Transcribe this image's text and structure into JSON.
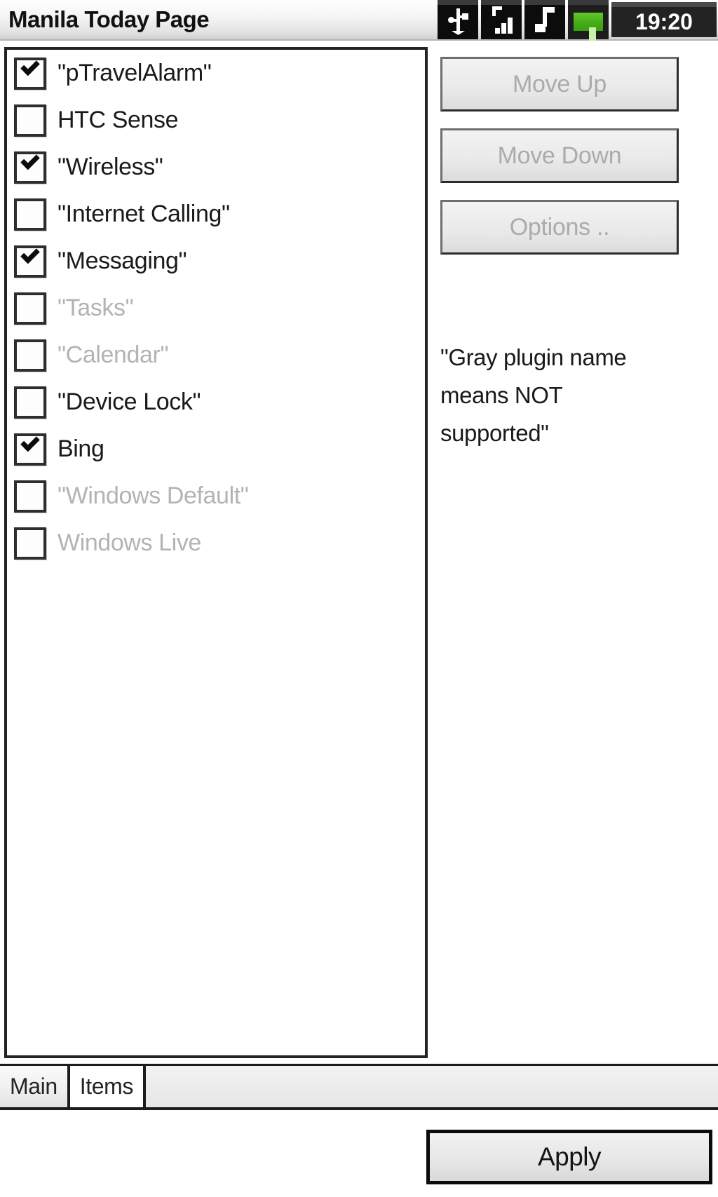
{
  "titlebar": {
    "title": "Manila Today Page",
    "icons": [
      {
        "name": "usb-icon"
      },
      {
        "name": "signal-bars-icon"
      },
      {
        "name": "music-note-icon"
      },
      {
        "name": "battery-icon"
      }
    ],
    "clock": "19:20"
  },
  "plugin_list": {
    "items": [
      {
        "label": "\"pTravelAlarm\"",
        "checked": true,
        "disabled": false
      },
      {
        "label": "HTC Sense",
        "checked": false,
        "disabled": false
      },
      {
        "label": "\"Wireless\"",
        "checked": true,
        "disabled": false
      },
      {
        "label": "\"Internet Calling\"",
        "checked": false,
        "disabled": false
      },
      {
        "label": "\"Messaging\"",
        "checked": true,
        "disabled": false
      },
      {
        "label": "\"Tasks\"",
        "checked": false,
        "disabled": true
      },
      {
        "label": "\"Calendar\"",
        "checked": false,
        "disabled": true
      },
      {
        "label": "\"Device Lock\"",
        "checked": false,
        "disabled": false
      },
      {
        "label": "Bing",
        "checked": true,
        "disabled": false
      },
      {
        "label": "\"Windows Default\"",
        "checked": false,
        "disabled": true
      },
      {
        "label": "Windows Live",
        "checked": false,
        "disabled": true
      }
    ]
  },
  "side_buttons": [
    {
      "label": "Move Up",
      "enabled": false
    },
    {
      "label": "Move Down",
      "enabled": false
    },
    {
      "label": "Options ..",
      "enabled": false
    }
  ],
  "help_note": "\"Gray plugin name means NOT supported\"",
  "tabs": [
    {
      "label": "Main",
      "active": false
    },
    {
      "label": "Items",
      "active": true
    }
  ],
  "footer": {
    "apply_label": "Apply"
  },
  "colors": {
    "frame": "#232323",
    "disabled_text": "#b3b3b3",
    "battery_green": "#4aba18",
    "clock_bg": "#232323"
  }
}
